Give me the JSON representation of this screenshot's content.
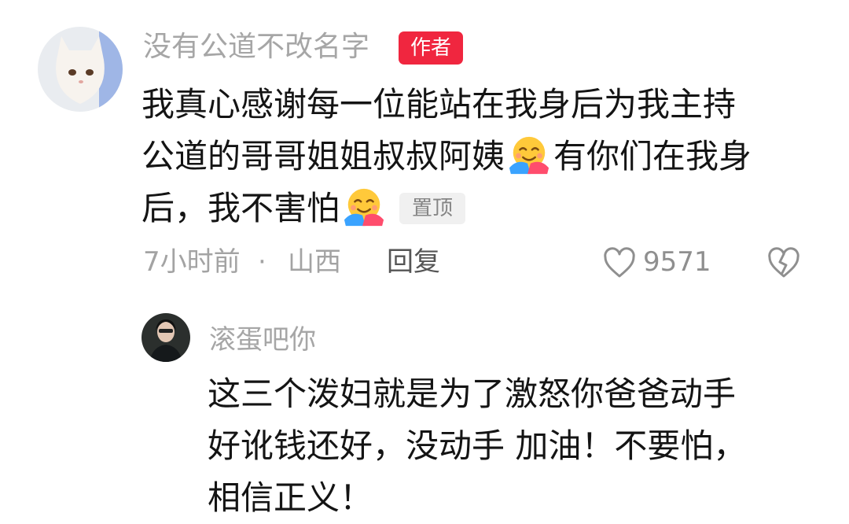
{
  "comment": {
    "username": "没有公道不改名字",
    "author_badge": "作者",
    "lines": [
      "我真心感谢每一位能站在我身后为我主持",
      "公道的哥哥姐姐叔叔阿姨",
      "有你们在我身",
      "后，我不害怕"
    ],
    "pinned_label": "置顶",
    "time": "7小时前",
    "separator": "·",
    "location": "山西",
    "reply_label": "回复",
    "like_count": "9571",
    "icons": [
      "heart-outline-icon",
      "broken-heart-icon",
      "hugging-face-emoji"
    ]
  },
  "reply": {
    "username": "滚蛋吧你",
    "lines": [
      "这三个泼妇就是为了激怒你爸爸动手",
      "好讹钱还好，没动手 加油！不要怕，",
      "相信正义！"
    ]
  },
  "colors": {
    "badge": "#f0263f",
    "username": "#a6a6a6",
    "text": "#141414",
    "meta": "#a3a3a3"
  }
}
